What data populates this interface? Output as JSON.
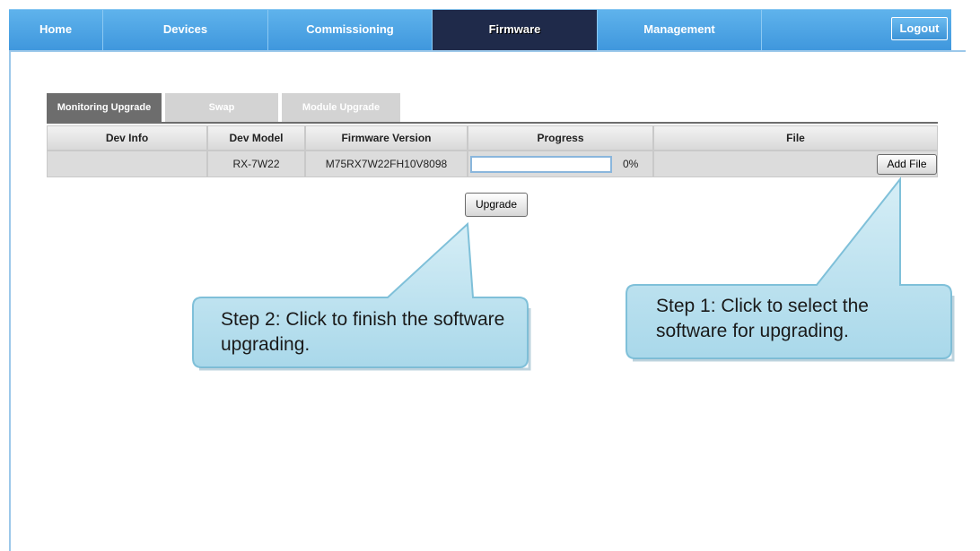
{
  "nav": {
    "items": [
      "Home",
      "Devices",
      "Commissioning",
      "Firmware",
      "Management"
    ],
    "active": "Firmware",
    "logout": "Logout"
  },
  "tabs": [
    "Monitoring Upgrade",
    "Swap",
    "Module Upgrade"
  ],
  "table": {
    "headers": [
      "Dev Info",
      "Dev Model",
      "Firmware Version",
      "Progress",
      "File"
    ],
    "row": {
      "dev_info": "",
      "dev_model": "RX-7W22",
      "firmware_version": "M75RX7W22FH10V8098",
      "progress_value": 0,
      "progress_text": "0%",
      "add_file": "Add File"
    }
  },
  "upgrade_button": "Upgrade",
  "callouts": {
    "step1": "Step 1: Click to select the software for upgrading.",
    "step2": "Step 2: Click to finish the software upgrading."
  },
  "colors": {
    "nav_bg": "#3f97dd",
    "nav_active": "#1f2a4a",
    "callout_fill": "#bfe3ef",
    "callout_border": "#7fc0d9"
  }
}
